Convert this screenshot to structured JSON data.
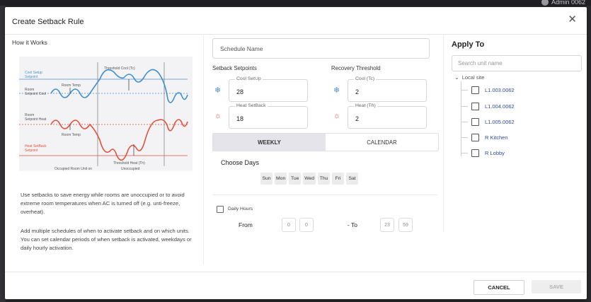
{
  "topbar": {
    "user": "Admin 0062"
  },
  "dialog": {
    "title": "Create Setback Rule"
  },
  "how_it_works": {
    "heading": "How it Works",
    "diagram": {
      "threshold_cool": "Threshold Cool (Tc)",
      "cool_setup": [
        "Cool Setup",
        "Setpoint"
      ],
      "room_temp_top": "Room Temp",
      "room_setpoint_cool": [
        "Room",
        "Setpoint Cool"
      ],
      "room_setpoint_heat": [
        "Room",
        "Setpoint Heat"
      ],
      "room_temp_bottom": "Room Temp",
      "heat_setback": [
        "Heat SetBack",
        "Setpoint"
      ],
      "threshold_heat": "Threshold Heat (Th)",
      "occupied": "Occupied Room Unit on",
      "unoccupied": "Unoccupied"
    },
    "para1": "Use setbacks to save energy while rooms are unoccupied or to avoid extreme room temperatures when AC is turned off (e.g. unti-freeze, overheat).",
    "para2": "Add multiple schedules of when to activate setback and on which units. You can set calendar periods of when setback is activated, weekdays or daily hourly activation."
  },
  "form": {
    "schedule_name_placeholder": "Schedule Name",
    "setback_setpoints_label": "Setback Setpoints",
    "recovery_threshold_label": "Recovery Threshold",
    "cool_setup": {
      "label": "Cool SetUp",
      "value": "28"
    },
    "heat_setback": {
      "label": "Heat SetBack",
      "value": "18"
    },
    "cool_tc": {
      "label": "Cool (Tc)",
      "value": "2"
    },
    "heat_th": {
      "label": "Heat (Th)",
      "value": "2"
    },
    "tabs": [
      {
        "label": "WEEKLY",
        "active": true
      },
      {
        "label": "CALENDAR",
        "active": false
      }
    ],
    "choose_days": "Choose Days",
    "days": [
      "Sun",
      "Mon",
      "Tue",
      "Wed",
      "Thu",
      "Fri",
      "Sat"
    ],
    "daily_hours": "Daily Hours",
    "from_label": "From",
    "to_label": "- To",
    "from_hour": "0",
    "from_min": "0",
    "to_hour": "23",
    "to_min": "59"
  },
  "apply_to": {
    "heading": "Apply To",
    "search_placeholder": "Search unit name",
    "root": "Local site",
    "units": [
      "L1.003.0062",
      "L1.004.0062",
      "L1.005.0062",
      "R Kitchen",
      "R Lobby"
    ]
  },
  "footer": {
    "cancel": "CANCEL",
    "save": "SAVE"
  },
  "colors": {
    "cool": "#4a90c8",
    "heat": "#e1523e",
    "accent_link": "#2e4aa0"
  }
}
